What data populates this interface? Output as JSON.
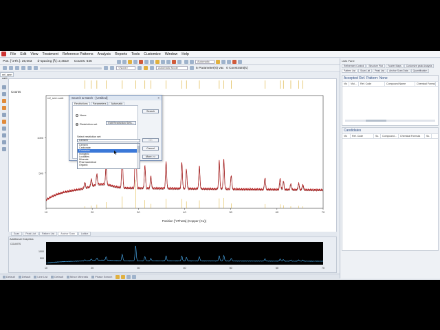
{
  "menu": {
    "items": [
      "File",
      "Edit",
      "View",
      "Treatment",
      "Reference Patterns",
      "Analysis",
      "Reports",
      "Tools",
      "Customize",
      "Window",
      "Help"
    ]
  },
  "status": {
    "pos": "Pos. [°2Th.]: 36,003",
    "dspacing": "d-spacing [Å]: 2,4519",
    "counts": "Counts: 646"
  },
  "toolbar": {
    "mode_field": "<None>",
    "automatic": "Automatic",
    "automatic_mode": "Automatic Mode",
    "parameters": "5 Parameter(s) var.",
    "constraints": "0 Constraint(s)"
  },
  "document": {
    "tab": "ref_sem carb"
  },
  "chart": {
    "y_label": "Counts",
    "x_label": "Position [°2Theta] (Copper (Cu))",
    "doc_label": "ref_sem carb",
    "y_ticks": [
      "1000",
      "500"
    ],
    "x_ticks": [
      "10",
      "20",
      "30",
      "40",
      "50",
      "60",
      "70"
    ]
  },
  "chart_data": {
    "type": "line",
    "title": "",
    "xlabel": "Position [°2Theta] (Copper (Cu))",
    "ylabel": "Counts",
    "xlim": [
      10,
      70
    ],
    "ylim": [
      0,
      1600
    ],
    "x_ticks": [
      10,
      20,
      30,
      40,
      50,
      60,
      70
    ],
    "y_ticks": [
      500,
      1000
    ],
    "grid": false,
    "peaks": [
      {
        "x": 18.4,
        "y": 80
      },
      {
        "x": 19.8,
        "y": 110
      },
      {
        "x": 21.0,
        "y": 150
      },
      {
        "x": 23.0,
        "y": 250
      },
      {
        "x": 26.5,
        "y": 480
      },
      {
        "x": 29.4,
        "y": 1150
      },
      {
        "x": 31.4,
        "y": 330
      },
      {
        "x": 32.7,
        "y": 180
      },
      {
        "x": 36.0,
        "y": 380
      },
      {
        "x": 39.4,
        "y": 380
      },
      {
        "x": 40.4,
        "y": 280
      },
      {
        "x": 43.2,
        "y": 320
      },
      {
        "x": 47.5,
        "y": 400
      },
      {
        "x": 48.5,
        "y": 420
      },
      {
        "x": 50.1,
        "y": 200
      },
      {
        "x": 57.4,
        "y": 170
      },
      {
        "x": 60.7,
        "y": 160
      },
      {
        "x": 61.4,
        "y": 120
      },
      {
        "x": 63.0,
        "y": 80
      },
      {
        "x": 64.7,
        "y": 100
      },
      {
        "x": 65.6,
        "y": 80
      }
    ]
  },
  "dialog": {
    "title": "Search & Match - [Untitled]",
    "close": "×",
    "tabs": [
      "Restrictions",
      "Parameters",
      "Automatic"
    ],
    "radio_none": "None",
    "radio_restriction": "Restriction set",
    "edit_restriction": "Edit Restriction Sets...",
    "select_label": "Select restriction set:",
    "combo_value": "Cement",
    "list_items": [
      "Cement",
      "Carbonate",
      "Corrosion",
      "Inorganic",
      "Localities",
      "Minerals",
      "Pharmaceutical",
      "Organic"
    ],
    "selected_index": 2,
    "btn_search": "Search",
    "btn_ok": "OK",
    "btn_cancel": "Cancel",
    "btn_more": "More >>"
  },
  "bottom_tabs": [
    "Scan",
    "Peak List",
    "Pattern List",
    "Anchor Scan",
    "Lattice"
  ],
  "additional_graphics": {
    "title": "Additional Graphics",
    "y_label": "COUNTS",
    "y_ticks": [
      "1000",
      "500"
    ],
    "x_ticks": [
      "10",
      "20",
      "30",
      "40",
      "50",
      "60",
      "70"
    ]
  },
  "bottom_bar": [
    "Default",
    "Default",
    "Line List",
    "Default",
    "Minor Minerals",
    "Phase Search"
  ],
  "right_panel": {
    "title": "Lists Pane",
    "tabs": [
      "Refinement Control",
      "Structure Plot",
      "Fourier Maps",
      "Customize peak Analysis",
      "Pattern List",
      "Scan List",
      "Peak List",
      "Anchor Scan Data",
      "Quantification"
    ],
    "active_tab": "Pattern List",
    "accepted_title": "Accepted Ref. Pattern: None",
    "accepted_cols": [
      "Vis",
      "Visi...",
      "Ref. Code",
      "Compound Name",
      "Chemical Formula"
    ],
    "candidates_title": "Candidates",
    "candidate_cols": [
      "Vis",
      "Ref. Code",
      "Sc.",
      "Compound...",
      "Chemical Formula",
      "Sc."
    ]
  }
}
